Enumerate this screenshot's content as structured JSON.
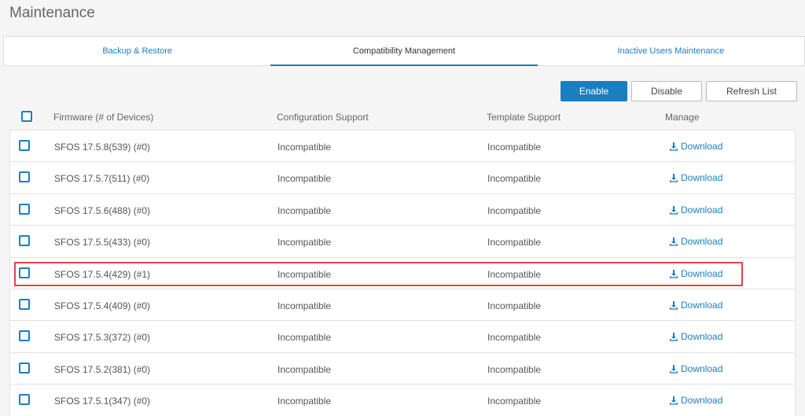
{
  "page": {
    "title": "Maintenance"
  },
  "tabs": [
    {
      "label": "Backup & Restore",
      "active": false
    },
    {
      "label": "Compatibility Management",
      "active": true
    },
    {
      "label": "Inactive Users Maintenance",
      "active": false
    }
  ],
  "toolbar": {
    "enable": "Enable",
    "disable": "Disable",
    "refresh": "Refresh List"
  },
  "table": {
    "headers": {
      "firmware": "Firmware (# of Devices)",
      "config": "Configuration Support",
      "template": "Template Support",
      "manage": "Manage"
    },
    "download_label": "Download",
    "rows": [
      {
        "firmware": "SFOS 17.5.8(539) (#0)",
        "config": "Incompatible",
        "template": "Incompatible"
      },
      {
        "firmware": "SFOS 17.5.7(511) (#0)",
        "config": "Incompatible",
        "template": "Incompatible"
      },
      {
        "firmware": "SFOS 17.5.6(488) (#0)",
        "config": "Incompatible",
        "template": "Incompatible"
      },
      {
        "firmware": "SFOS 17.5.5(433) (#0)",
        "config": "Incompatible",
        "template": "Incompatible"
      },
      {
        "firmware": "SFOS 17.5.4(429) (#1)",
        "config": "Incompatible",
        "template": "Incompatible"
      },
      {
        "firmware": "SFOS 17.5.4(409) (#0)",
        "config": "Incompatible",
        "template": "Incompatible"
      },
      {
        "firmware": "SFOS 17.5.3(372) (#0)",
        "config": "Incompatible",
        "template": "Incompatible"
      },
      {
        "firmware": "SFOS 17.5.2(381) (#0)",
        "config": "Incompatible",
        "template": "Incompatible"
      },
      {
        "firmware": "SFOS 17.5.1(347) (#0)",
        "config": "Incompatible",
        "template": "Incompatible"
      }
    ]
  },
  "icons": {
    "download": "download-icon",
    "checkbox": "checkbox-icon"
  },
  "colors": {
    "accent": "#1a7fc1",
    "highlight": "#e0454b"
  }
}
